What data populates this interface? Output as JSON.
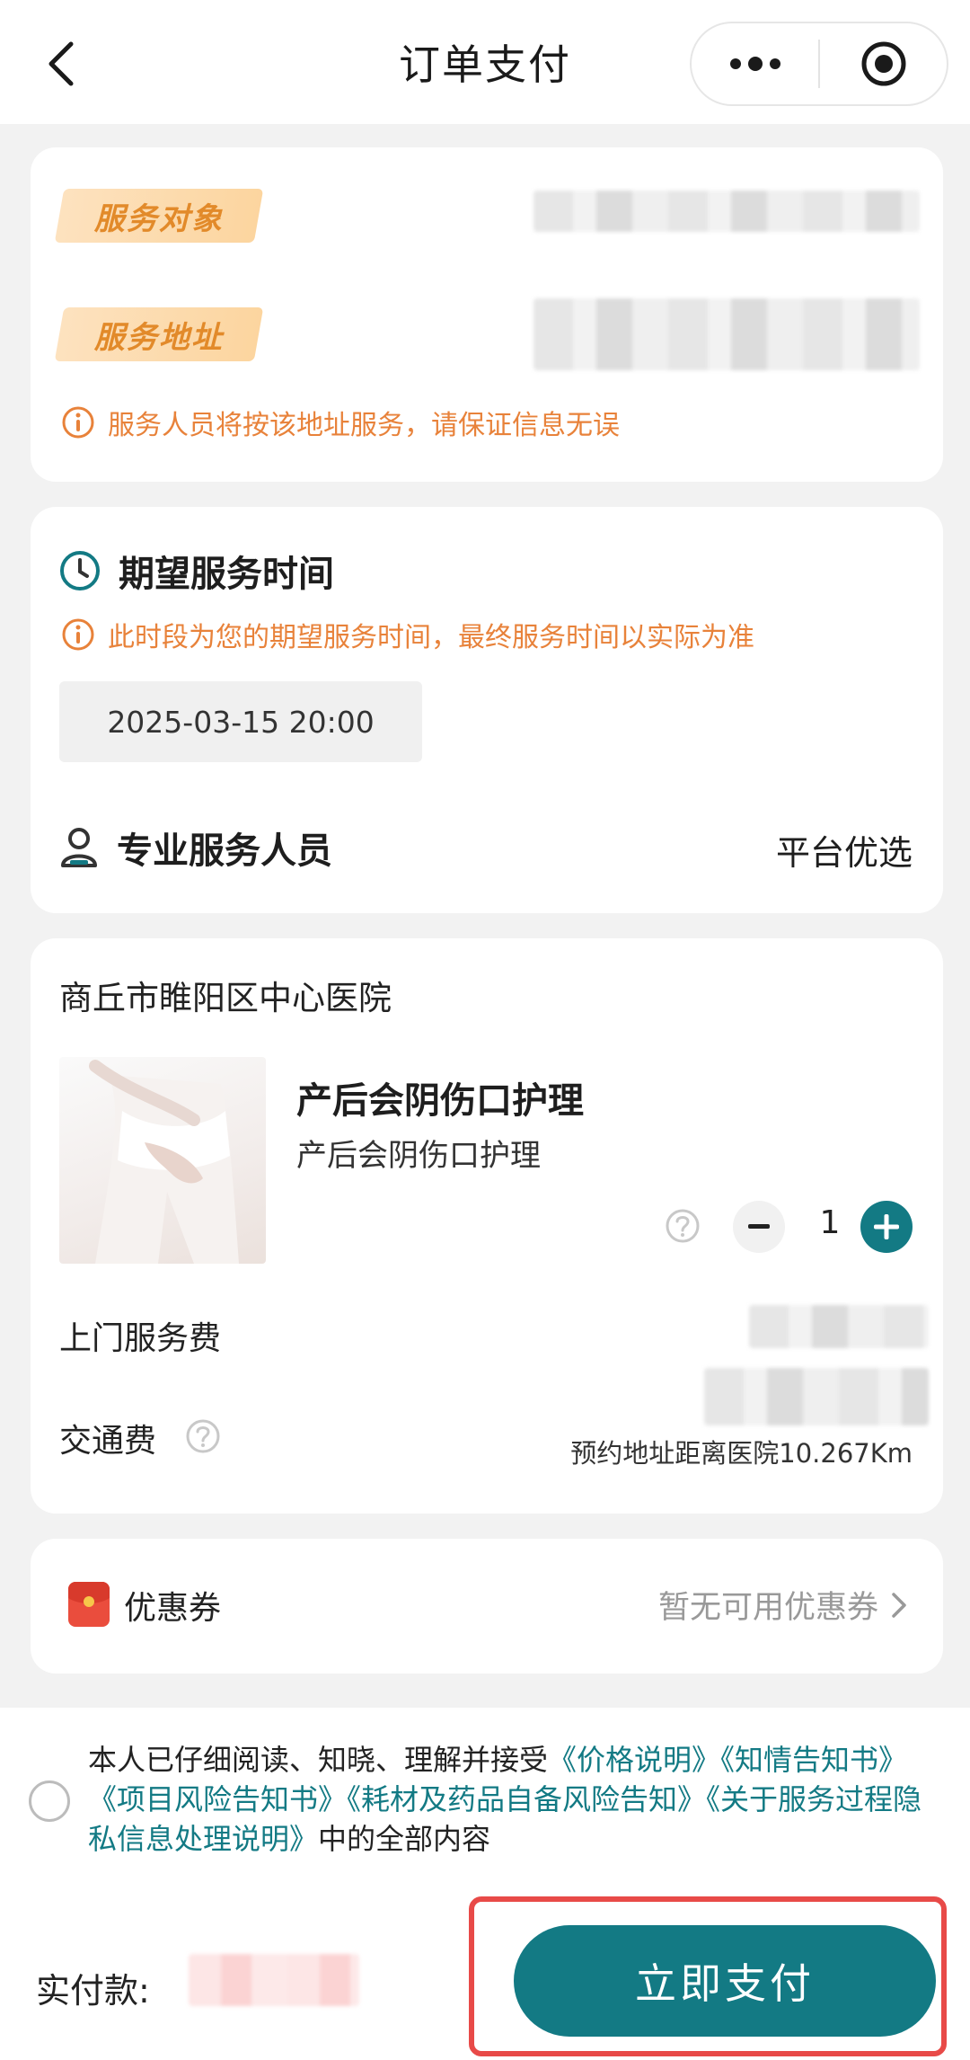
{
  "header": {
    "title": "订单支付"
  },
  "service_info": {
    "target_tag": "服务对象",
    "address_tag": "服务地址",
    "notice": "服务人员将按该地址服务，请保证信息无误"
  },
  "schedule": {
    "title": "期望服务时间",
    "notice": "此时段为您的期望服务时间，最终服务时间以实际为准",
    "time_value": "2025-03-15 20:00",
    "staff_label": "专业服务人员",
    "staff_value": "平台优选"
  },
  "order": {
    "hospital": "商丘市睢阳区中心医院",
    "product_name": "产后会阴伤口护理",
    "product_subtitle": "产后会阴伤口护理",
    "quantity": "1",
    "service_fee_label": "上门服务费",
    "traffic_fee_label": "交通费",
    "distance_note": "预约地址距离医院10.267Km"
  },
  "coupon": {
    "label": "优惠券",
    "value": "暂无可用优惠券"
  },
  "agreement": {
    "prefix": "本人已仔细阅读、知晓、理解并接受",
    "links": [
      "《价格说明》",
      "《知情告知书》",
      "《项目风险告知书》",
      "《耗材及药品自备风险告知》",
      "《关于服务过程隐私信息处理说明》"
    ],
    "suffix": "中的全部内容"
  },
  "footer": {
    "pay_label": "实付款:",
    "pay_button": "立即支付"
  },
  "colors": {
    "primary": "#137a84",
    "warning": "#e8823a",
    "tag_text": "#e28a2a",
    "highlight": "#e84a48"
  }
}
